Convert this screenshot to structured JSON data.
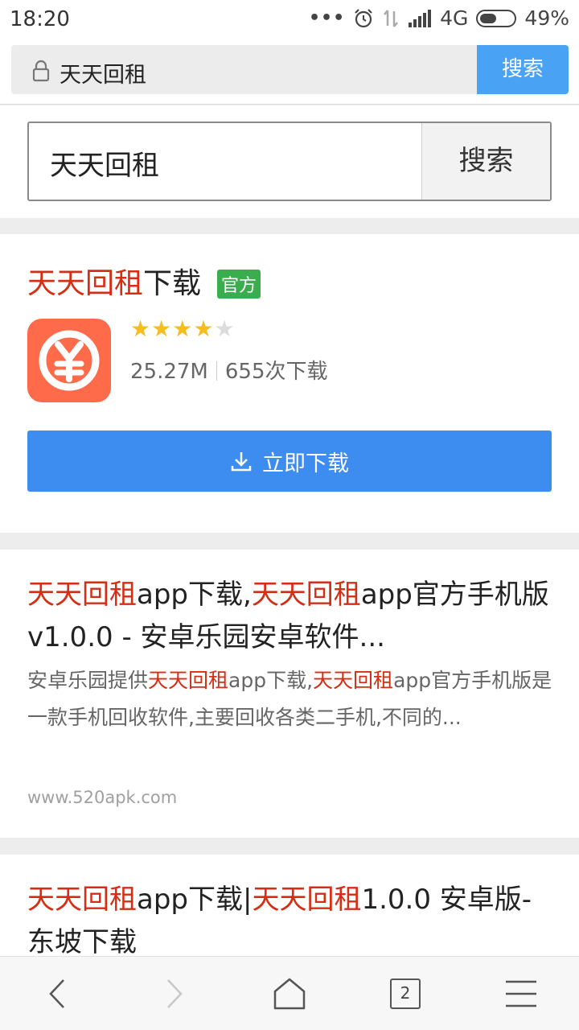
{
  "status_bar": {
    "time": "18:20",
    "signal": "4G",
    "battery": "49%",
    "battery_level": 0.49
  },
  "browser": {
    "url_text": "天天回租",
    "search_label": "搜索"
  },
  "search": {
    "query": "天天回租",
    "button_label": "搜索"
  },
  "app_card": {
    "title_highlight": "天天回租",
    "title_suffix": "下载",
    "badge": "官方",
    "rating": 4,
    "rating_max": 5,
    "size": "25.27M",
    "downloads": "655次下载",
    "download_label": "立即下载",
    "icon_color": "#fe6b4a"
  },
  "results": [
    {
      "title_parts": [
        "天天回租",
        "app下载,",
        "天天回租",
        "app官方手机版 v1.0.0 - 安卓乐园安卓软件..."
      ],
      "desc_parts": [
        "安卓乐园提供",
        "天天回租",
        "app下载,",
        "天天回租",
        "app官方手机版是一款手机回收软件,主要回收各类二手机,不同的..."
      ],
      "url": "www.520apk.com"
    },
    {
      "title_parts": [
        "天天回租",
        "app下载|",
        "天天回租",
        "1.0.0 安卓版-东坡下载"
      ]
    }
  ],
  "bottom_nav": {
    "tab_count": "2"
  },
  "colors": {
    "accent_blue": "#3d8cf0",
    "highlight_red": "#d52e14",
    "badge_green": "#3aae4f",
    "star_yellow": "#f5bd1f"
  }
}
